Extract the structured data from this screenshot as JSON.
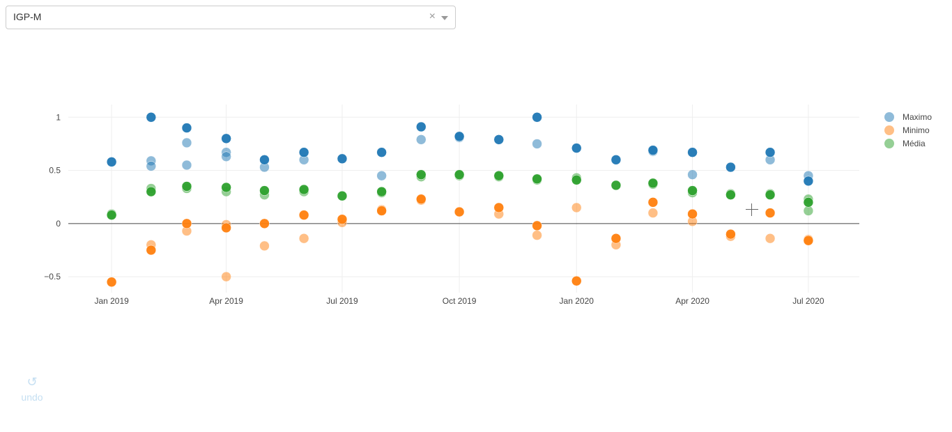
{
  "selector": {
    "value": "IGP-M",
    "clear_icon": "×"
  },
  "undo": {
    "label": "undo",
    "icon": "↺"
  },
  "chart_data": {
    "type": "scatter",
    "x_ticks": [
      "Jan 2019",
      "Apr 2019",
      "Jul 2019",
      "Oct 2019",
      "Jan 2020",
      "Apr 2020",
      "Jul 2020"
    ],
    "y_ticks": [
      "1",
      "0.5",
      "0",
      "−0.5"
    ],
    "ylim": [
      -0.65,
      1.12
    ],
    "xlim": [
      "2018-11-28",
      "2020-08-10"
    ],
    "grid": true,
    "legend_position": "top-right",
    "series": [
      {
        "name": "Maximo",
        "color": "#1f77b4",
        "points": [
          {
            "x": "2019-01-01",
            "y": 0.58,
            "o": 1
          },
          {
            "x": "2019-02-01",
            "y": 1.0,
            "o": 1
          },
          {
            "x": "2019-02-01",
            "y": 0.59,
            "o": 0.5
          },
          {
            "x": "2019-02-01",
            "y": 0.54,
            "o": 0.5
          },
          {
            "x": "2019-03-01",
            "y": 0.9,
            "o": 1
          },
          {
            "x": "2019-03-01",
            "y": 0.76,
            "o": 0.5
          },
          {
            "x": "2019-03-01",
            "y": 0.55,
            "o": 0.5
          },
          {
            "x": "2019-04-01",
            "y": 0.8,
            "o": 1
          },
          {
            "x": "2019-04-01",
            "y": 0.67,
            "o": 0.5
          },
          {
            "x": "2019-04-01",
            "y": 0.63,
            "o": 0.5
          },
          {
            "x": "2019-05-01",
            "y": 0.6,
            "o": 1
          },
          {
            "x": "2019-05-01",
            "y": 0.53,
            "o": 0.5
          },
          {
            "x": "2019-06-01",
            "y": 0.67,
            "o": 1
          },
          {
            "x": "2019-06-01",
            "y": 0.6,
            "o": 0.5
          },
          {
            "x": "2019-07-01",
            "y": 0.61,
            "o": 1
          },
          {
            "x": "2019-08-01",
            "y": 0.67,
            "o": 1
          },
          {
            "x": "2019-08-01",
            "y": 0.45,
            "o": 0.5
          },
          {
            "x": "2019-09-01",
            "y": 0.91,
            "o": 1
          },
          {
            "x": "2019-09-01",
            "y": 0.79,
            "o": 0.5
          },
          {
            "x": "2019-10-01",
            "y": 0.82,
            "o": 1
          },
          {
            "x": "2019-10-01",
            "y": 0.81,
            "o": 0.5
          },
          {
            "x": "2019-11-01",
            "y": 0.79,
            "o": 1
          },
          {
            "x": "2019-12-01",
            "y": 1.0,
            "o": 1
          },
          {
            "x": "2019-12-01",
            "y": 0.75,
            "o": 0.5
          },
          {
            "x": "2020-01-01",
            "y": 0.71,
            "o": 1
          },
          {
            "x": "2020-02-01",
            "y": 0.6,
            "o": 1
          },
          {
            "x": "2020-03-01",
            "y": 0.69,
            "o": 1
          },
          {
            "x": "2020-03-01",
            "y": 0.68,
            "o": 0.5
          },
          {
            "x": "2020-04-01",
            "y": 0.67,
            "o": 1
          },
          {
            "x": "2020-04-01",
            "y": 0.46,
            "o": 0.5
          },
          {
            "x": "2020-05-01",
            "y": 0.53,
            "o": 1
          },
          {
            "x": "2020-06-01",
            "y": 0.67,
            "o": 1
          },
          {
            "x": "2020-06-01",
            "y": 0.6,
            "o": 0.5
          },
          {
            "x": "2020-07-01",
            "y": 0.4,
            "o": 1
          },
          {
            "x": "2020-07-01",
            "y": 0.45,
            "o": 0.5
          }
        ]
      },
      {
        "name": "Minimo",
        "color": "#ff7f0e",
        "points": [
          {
            "x": "2019-01-01",
            "y": -0.55,
            "o": 1
          },
          {
            "x": "2019-02-01",
            "y": -0.25,
            "o": 1
          },
          {
            "x": "2019-02-01",
            "y": -0.2,
            "o": 0.5
          },
          {
            "x": "2019-03-01",
            "y": 0.0,
            "o": 1
          },
          {
            "x": "2019-03-01",
            "y": -0.07,
            "o": 0.5
          },
          {
            "x": "2019-04-01",
            "y": -0.04,
            "o": 1
          },
          {
            "x": "2019-04-01",
            "y": -0.01,
            "o": 0.5
          },
          {
            "x": "2019-04-01",
            "y": -0.5,
            "o": 0.5
          },
          {
            "x": "2019-05-01",
            "y": 0.0,
            "o": 1
          },
          {
            "x": "2019-05-01",
            "y": -0.21,
            "o": 0.5
          },
          {
            "x": "2019-06-01",
            "y": 0.08,
            "o": 1
          },
          {
            "x": "2019-06-01",
            "y": -0.14,
            "o": 0.5
          },
          {
            "x": "2019-07-01",
            "y": 0.04,
            "o": 1
          },
          {
            "x": "2019-07-01",
            "y": 0.01,
            "o": 0.5
          },
          {
            "x": "2019-08-01",
            "y": 0.12,
            "o": 1
          },
          {
            "x": "2019-08-01",
            "y": 0.13,
            "o": 0.5
          },
          {
            "x": "2019-09-01",
            "y": 0.23,
            "o": 1
          },
          {
            "x": "2019-09-01",
            "y": 0.22,
            "o": 0.5
          },
          {
            "x": "2019-10-01",
            "y": 0.11,
            "o": 1
          },
          {
            "x": "2019-11-01",
            "y": 0.15,
            "o": 1
          },
          {
            "x": "2019-11-01",
            "y": 0.09,
            "o": 0.5
          },
          {
            "x": "2019-12-01",
            "y": -0.02,
            "o": 1
          },
          {
            "x": "2019-12-01",
            "y": -0.11,
            "o": 0.5
          },
          {
            "x": "2020-01-01",
            "y": -0.54,
            "o": 1
          },
          {
            "x": "2020-01-01",
            "y": 0.15,
            "o": 0.5
          },
          {
            "x": "2020-02-01",
            "y": -0.14,
            "o": 1
          },
          {
            "x": "2020-02-01",
            "y": -0.2,
            "o": 0.5
          },
          {
            "x": "2020-03-01",
            "y": 0.2,
            "o": 1
          },
          {
            "x": "2020-03-01",
            "y": 0.1,
            "o": 0.5
          },
          {
            "x": "2020-04-01",
            "y": 0.09,
            "o": 1
          },
          {
            "x": "2020-04-01",
            "y": 0.02,
            "o": 0.5
          },
          {
            "x": "2020-05-01",
            "y": -0.1,
            "o": 1
          },
          {
            "x": "2020-05-01",
            "y": -0.12,
            "o": 0.5
          },
          {
            "x": "2020-06-01",
            "y": 0.1,
            "o": 1
          },
          {
            "x": "2020-06-01",
            "y": -0.14,
            "o": 0.5
          },
          {
            "x": "2020-07-01",
            "y": -0.16,
            "o": 1
          },
          {
            "x": "2020-07-01",
            "y": -0.15,
            "o": 0.5
          }
        ]
      },
      {
        "name": "Média",
        "color": "#2ca02c",
        "points": [
          {
            "x": "2019-01-01",
            "y": 0.08,
            "o": 1
          },
          {
            "x": "2019-01-01",
            "y": 0.09,
            "o": 0.5
          },
          {
            "x": "2019-02-01",
            "y": 0.3,
            "o": 1
          },
          {
            "x": "2019-02-01",
            "y": 0.33,
            "o": 0.5
          },
          {
            "x": "2019-03-01",
            "y": 0.35,
            "o": 1
          },
          {
            "x": "2019-03-01",
            "y": 0.33,
            "o": 0.5
          },
          {
            "x": "2019-04-01",
            "y": 0.34,
            "o": 1
          },
          {
            "x": "2019-04-01",
            "y": 0.3,
            "o": 0.5
          },
          {
            "x": "2019-05-01",
            "y": 0.31,
            "o": 1
          },
          {
            "x": "2019-05-01",
            "y": 0.27,
            "o": 0.5
          },
          {
            "x": "2019-06-01",
            "y": 0.32,
            "o": 1
          },
          {
            "x": "2019-06-01",
            "y": 0.3,
            "o": 0.5
          },
          {
            "x": "2019-07-01",
            "y": 0.26,
            "o": 1
          },
          {
            "x": "2019-08-01",
            "y": 0.3,
            "o": 1
          },
          {
            "x": "2019-08-01",
            "y": 0.29,
            "o": 0.5
          },
          {
            "x": "2019-09-01",
            "y": 0.46,
            "o": 1
          },
          {
            "x": "2019-09-01",
            "y": 0.44,
            "o": 0.5
          },
          {
            "x": "2019-10-01",
            "y": 0.46,
            "o": 1
          },
          {
            "x": "2019-10-01",
            "y": 0.45,
            "o": 0.5
          },
          {
            "x": "2019-11-01",
            "y": 0.45,
            "o": 1
          },
          {
            "x": "2019-11-01",
            "y": 0.44,
            "o": 0.5
          },
          {
            "x": "2019-12-01",
            "y": 0.42,
            "o": 1
          },
          {
            "x": "2019-12-01",
            "y": 0.41,
            "o": 0.5
          },
          {
            "x": "2020-01-01",
            "y": 0.41,
            "o": 1
          },
          {
            "x": "2020-01-01",
            "y": 0.43,
            "o": 0.5
          },
          {
            "x": "2020-02-01",
            "y": 0.36,
            "o": 1
          },
          {
            "x": "2020-03-01",
            "y": 0.38,
            "o": 1
          },
          {
            "x": "2020-03-01",
            "y": 0.37,
            "o": 0.5
          },
          {
            "x": "2020-04-01",
            "y": 0.31,
            "o": 1
          },
          {
            "x": "2020-04-01",
            "y": 0.29,
            "o": 0.5
          },
          {
            "x": "2020-05-01",
            "y": 0.27,
            "o": 1
          },
          {
            "x": "2020-05-01",
            "y": 0.28,
            "o": 0.5
          },
          {
            "x": "2020-06-01",
            "y": 0.27,
            "o": 1
          },
          {
            "x": "2020-06-01",
            "y": 0.28,
            "o": 0.5
          },
          {
            "x": "2020-07-01",
            "y": 0.2,
            "o": 1
          },
          {
            "x": "2020-07-01",
            "y": 0.23,
            "o": 0.5
          },
          {
            "x": "2020-07-01",
            "y": 0.12,
            "o": 0.5
          }
        ]
      }
    ]
  }
}
